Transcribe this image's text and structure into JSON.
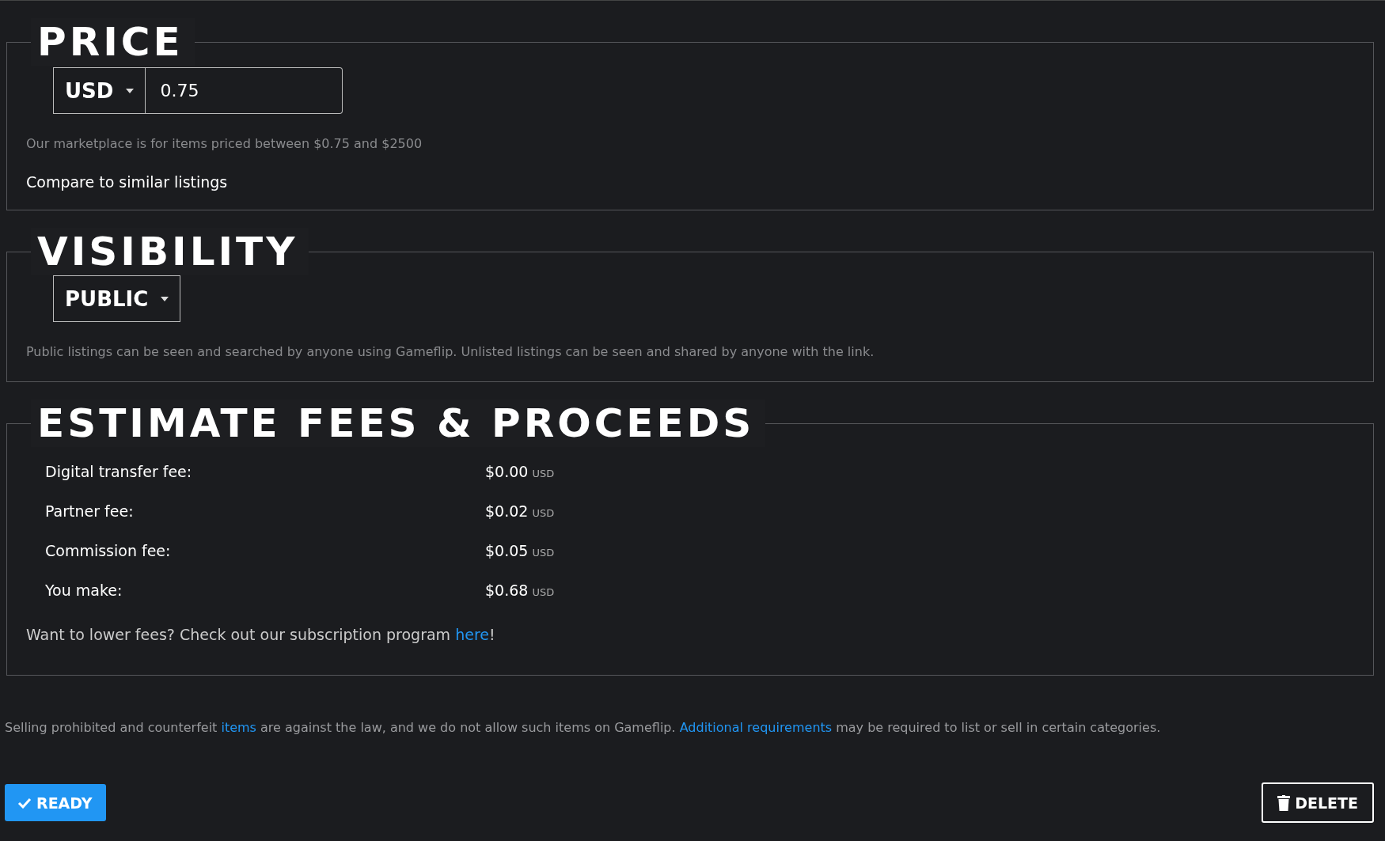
{
  "price": {
    "heading": "PRICE",
    "currency": "USD",
    "value": "0.75",
    "hint": "Our marketplace is for items priced between $0.75 and $2500",
    "compare_link": "Compare to similar listings"
  },
  "visibility": {
    "heading": "VISIBILITY",
    "option": "PUBLIC",
    "hint": "Public listings can be seen and searched by anyone using Gameflip. Unlisted listings can be seen and shared by anyone with the link."
  },
  "fees": {
    "heading": "ESTIMATE FEES & PROCEEDS",
    "rows": [
      {
        "label": "Digital transfer fee:",
        "amount": "$0.00",
        "unit": "USD"
      },
      {
        "label": "Partner fee:",
        "amount": "$0.02",
        "unit": "USD"
      },
      {
        "label": "Commission fee:",
        "amount": "$0.05",
        "unit": "USD"
      },
      {
        "label": "You make:",
        "amount": "$0.68",
        "unit": "USD"
      }
    ],
    "note": "Want to lower fees? Check out our subscription program",
    "note_link": "here",
    "note_end": "!"
  },
  "legal": {
    "part1": "Selling prohibited and counterfeit",
    "link1": "items",
    "part2": "are against the law, and we do not allow such items on Gameflip.",
    "link2": "Additional requirements",
    "part3": "may be required to list or sell in certain categories."
  },
  "buttons": {
    "ready": "READY",
    "delete": "DELETE"
  }
}
